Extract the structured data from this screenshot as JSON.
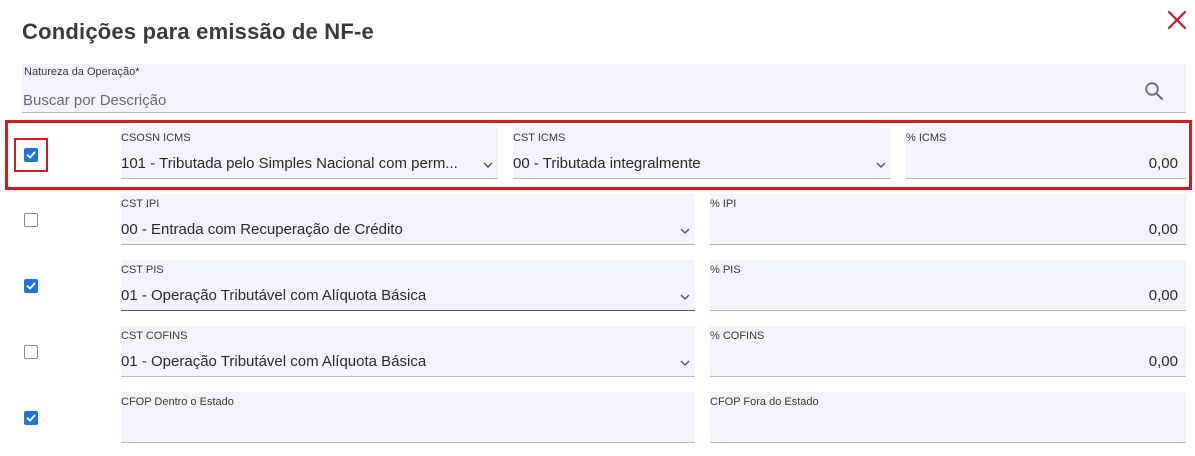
{
  "dialog": {
    "title": "Condições para emissão de NF-e",
    "close_icon": "close-icon",
    "accent_color": "#d71920"
  },
  "natureza": {
    "label": "Natureza da Operação*",
    "placeholder": "Buscar por Descrição",
    "icon": "search-icon"
  },
  "rows": {
    "icms": {
      "checked": true,
      "csosn": {
        "label": "CSOSN ICMS",
        "value": "101 - Tributada pelo Simples Nacional com perm..."
      },
      "cst": {
        "label": "CST ICMS",
        "value": "00 - Tributada integralmente"
      },
      "perc": {
        "label": "% ICMS",
        "value": "0,00"
      }
    },
    "ipi": {
      "checked": false,
      "cst": {
        "label": "CST IPI",
        "value": "00 - Entrada com Recuperação de Crédito"
      },
      "perc": {
        "label": "% IPI",
        "value": "0,00"
      }
    },
    "pis": {
      "checked": true,
      "cst": {
        "label": "CST PIS",
        "value": "01 - Operação Tributável com Alíquota Básica"
      },
      "perc": {
        "label": "% PIS",
        "value": "0,00"
      }
    },
    "cofins": {
      "checked": false,
      "cst": {
        "label": "CST COFINS",
        "value": "01 - Operação Tributável com Alíquota Básica"
      },
      "perc": {
        "label": "% COFINS",
        "value": "0,00"
      }
    },
    "cfop": {
      "checked": true,
      "dentro": {
        "label": "CFOP Dentro o Estado",
        "value": ""
      },
      "fora": {
        "label": "CFOP Fora do Estado",
        "value": ""
      }
    }
  },
  "colors": {
    "checkbox_checked": "#1f74d8",
    "field_background": "#f3f4fb",
    "highlight": "#d71920"
  }
}
